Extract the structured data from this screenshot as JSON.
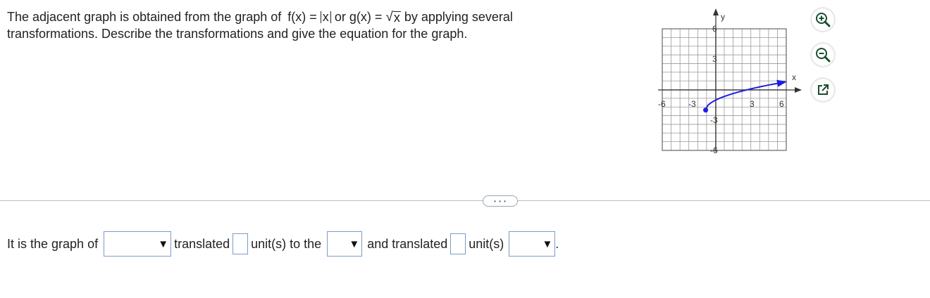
{
  "question": {
    "line1_prefix": "The adjacent graph is obtained from the graph of",
    "f_lhs": "f(x) =",
    "f_arg": "x",
    "or_text": "or",
    "g_lhs": "g(x) =",
    "g_radical": "√",
    "g_arg": "x",
    "line1_suffix": "by applying several",
    "line2": "transformations. Describe the transformations and give the equation for the graph."
  },
  "graph": {
    "x_label": "x",
    "y_label": "y",
    "x_ticks": [
      "-6",
      "-3",
      "3",
      "6"
    ],
    "y_ticks": [
      "6",
      "3",
      "-3",
      "-6"
    ],
    "xlim": [
      -7,
      7
    ],
    "ylim": [
      -7,
      7
    ],
    "curve_color": "#1f1fdc",
    "curve_start_point": [
      -1,
      -2
    ],
    "curve_arrow_end": [
      7,
      1
    ]
  },
  "tools": {
    "zoom_in_icon": "zoom-in-icon",
    "zoom_out_icon": "zoom-out-icon",
    "popout_icon": "popout-icon"
  },
  "more_button": {
    "label": "• • •"
  },
  "answer": {
    "prefix": "It is the graph of",
    "dropdown1_value": "",
    "translated1": "translated",
    "units_to_the": "unit(s) to the",
    "dropdown2_value": "",
    "and_translated": "and translated",
    "units": "unit(s)",
    "dropdown3_value": "",
    "period": "."
  }
}
